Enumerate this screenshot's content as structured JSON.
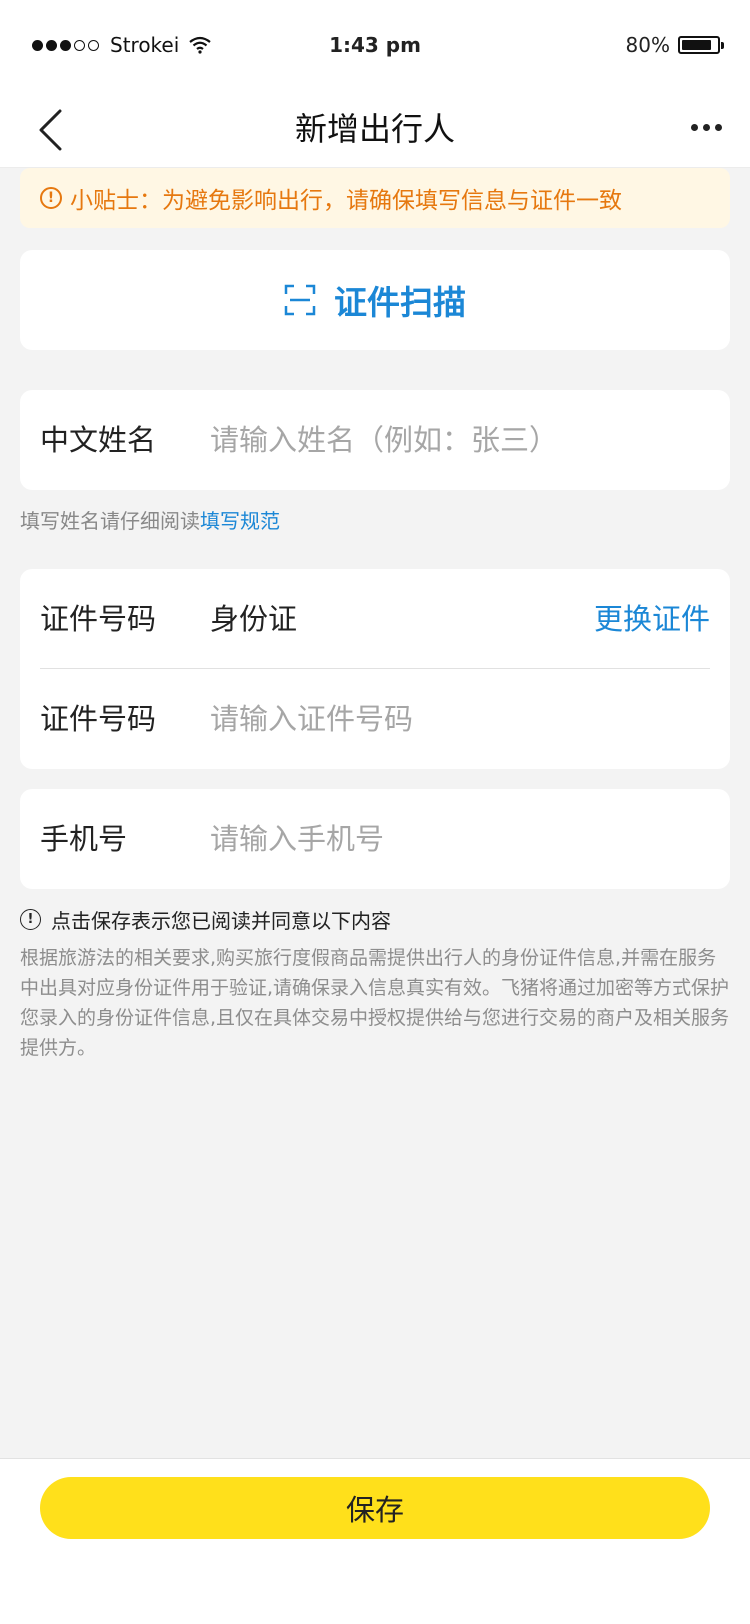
{
  "status_bar": {
    "carrier": "Strokei",
    "time": "1:43 pm",
    "battery": "80%"
  },
  "nav": {
    "title": "新增出行人",
    "back_icon": "chevron-left-icon",
    "more_icon": "more-dots-icon"
  },
  "tip": {
    "text": "小贴士：为避免影响出行，请确保填写信息与证件一致",
    "icon": "alert-circle-icon"
  },
  "scan": {
    "label": "证件扫描",
    "icon": "scan-frame-icon"
  },
  "name_field": {
    "label": "中文姓名",
    "placeholder": "请输入姓名（例如：张三）"
  },
  "name_hint": {
    "prefix": "填写姓名请仔细阅读",
    "link": "填写规范"
  },
  "id_type": {
    "label": "证件号码",
    "value": "身份证",
    "action": "更换证件"
  },
  "id_number": {
    "label": "证件号码",
    "placeholder": "请输入证件号码"
  },
  "phone": {
    "label": "手机号",
    "placeholder": "请输入手机号"
  },
  "agreement": {
    "title": "点击保存表示您已阅读并同意以下内容",
    "body": "根据旅游法的相关要求,购买旅行度假商品需提供出行人的身份证件信息,并需在服务中出具对应身份证件用于验证,请确保录入信息真实有效。飞猪将通过加密等方式保护您录入的身份证件信息,且仅在具体交易中授权提供给与您进行交易的商户及相关服务提供方。"
  },
  "footer": {
    "save_label": "保存"
  },
  "colors": {
    "accent_blue": "#1b87d6",
    "tip_orange": "#e6780f",
    "save_yellow": "#ffe01b"
  }
}
